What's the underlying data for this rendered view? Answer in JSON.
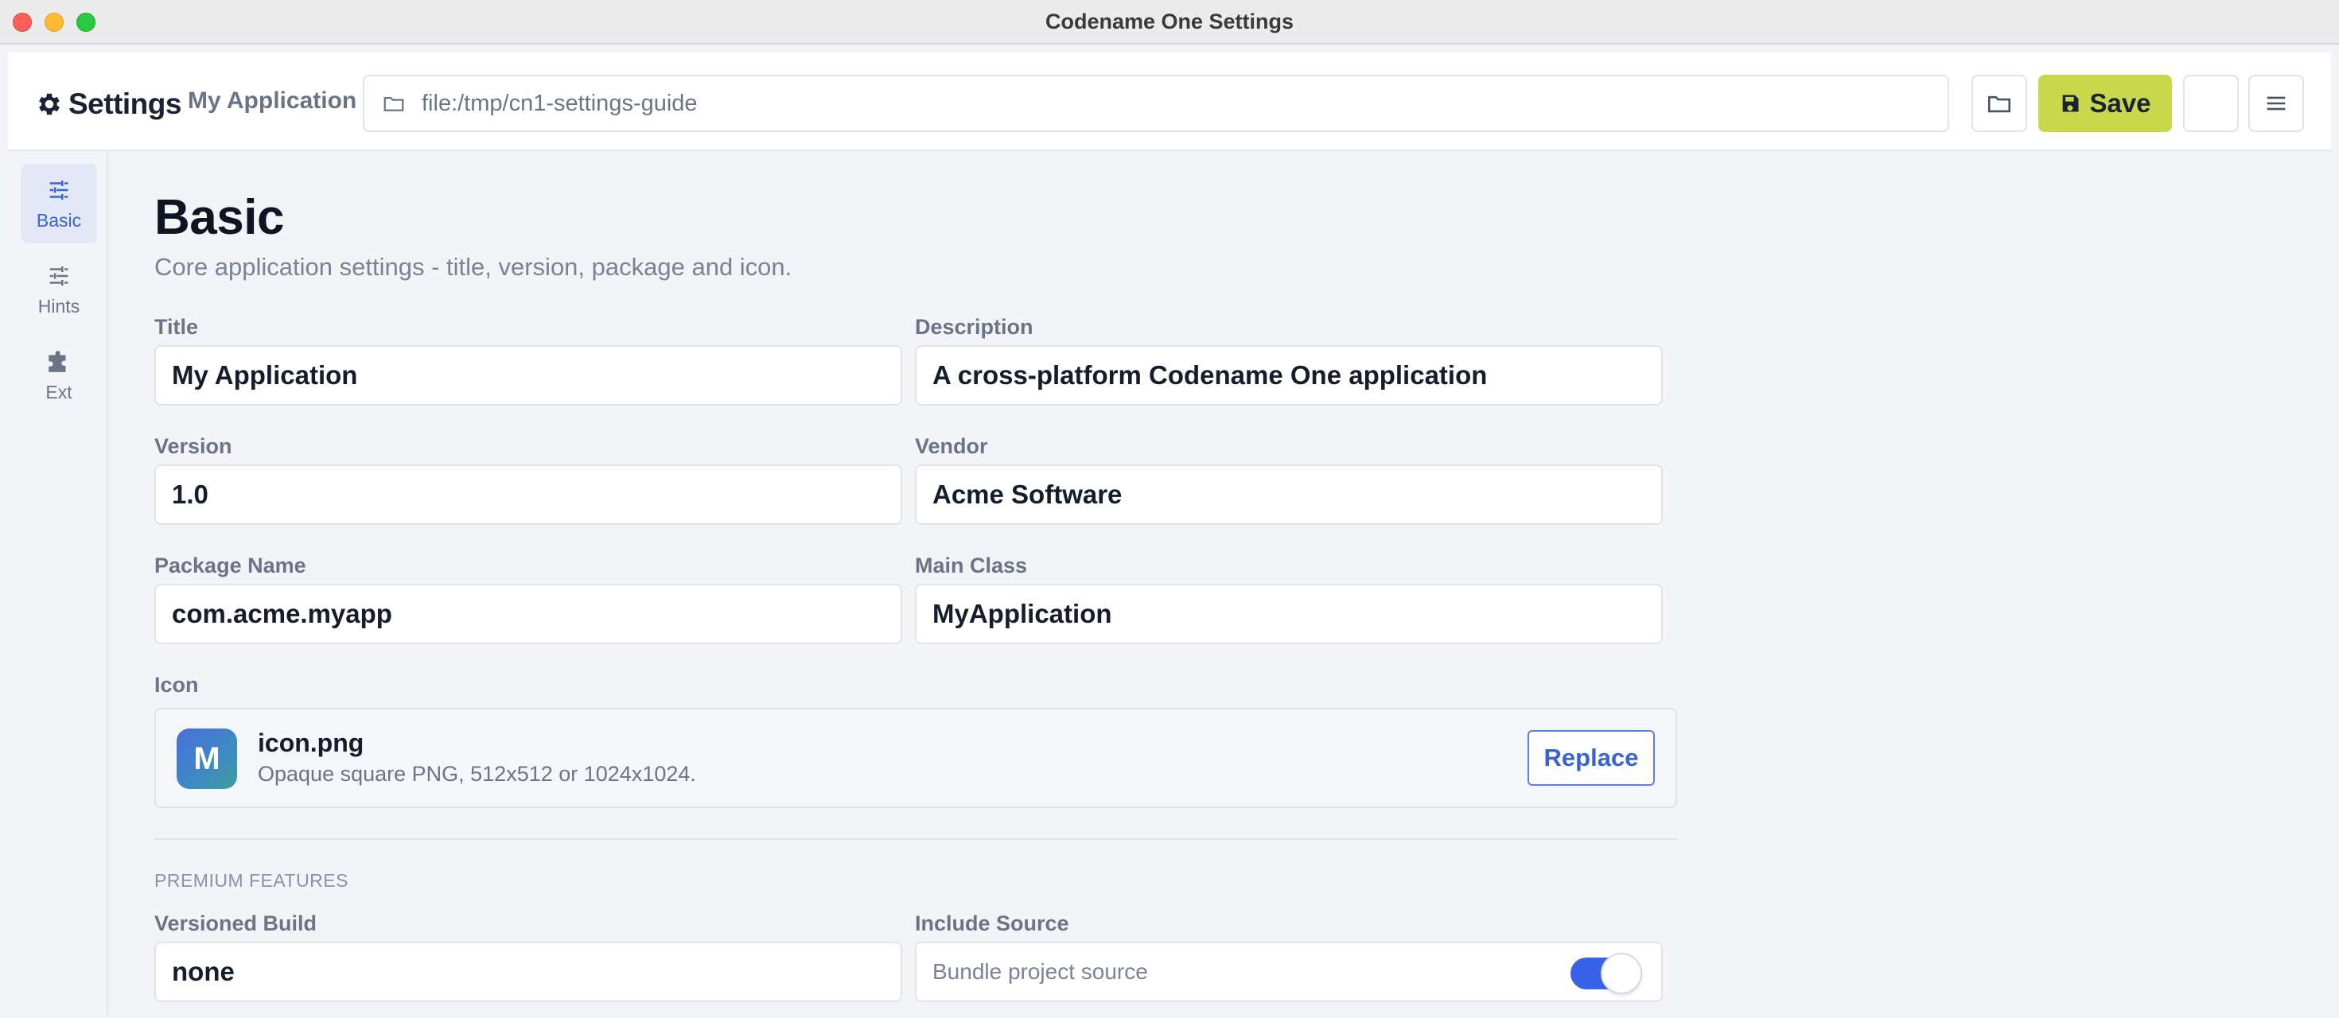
{
  "window": {
    "title": "Codename One Settings"
  },
  "header": {
    "brand_label": "Settings",
    "project_name": "My Application",
    "path": "file:/tmp/cn1-settings-guide",
    "save_label": "Save"
  },
  "sidebar": {
    "items": [
      {
        "label": "Basic",
        "icon": "sliders-icon",
        "active": true
      },
      {
        "label": "Hints",
        "icon": "sliders-icon",
        "active": false
      },
      {
        "label": "Ext",
        "icon": "puzzle-icon",
        "active": false
      }
    ]
  },
  "page": {
    "title": "Basic",
    "subtitle": "Core application settings - title, version, package and icon."
  },
  "fields": {
    "title": {
      "label": "Title",
      "value": "My Application"
    },
    "description": {
      "label": "Description",
      "value": "A cross-platform Codename One application"
    },
    "version": {
      "label": "Version",
      "value": "1.0"
    },
    "vendor": {
      "label": "Vendor",
      "value": "Acme Software"
    },
    "package_name": {
      "label": "Package Name",
      "value": "com.acme.myapp"
    },
    "main_class": {
      "label": "Main Class",
      "value": "MyApplication"
    }
  },
  "icon": {
    "label": "Icon",
    "letter": "M",
    "file_name": "icon.png",
    "hint": "Opaque square PNG, 512x512 or 1024x1024.",
    "replace_label": "Replace"
  },
  "premium": {
    "section_label": "PREMIUM FEATURES",
    "versioned_build": {
      "label": "Versioned Build",
      "value": "none"
    },
    "include_source": {
      "label": "Include Source",
      "toggle_text": "Bundle project source",
      "enabled": true
    }
  },
  "colors": {
    "accent": "#3a62d6",
    "save": "#c7d94a",
    "toggle_on": "#3a62e6"
  }
}
